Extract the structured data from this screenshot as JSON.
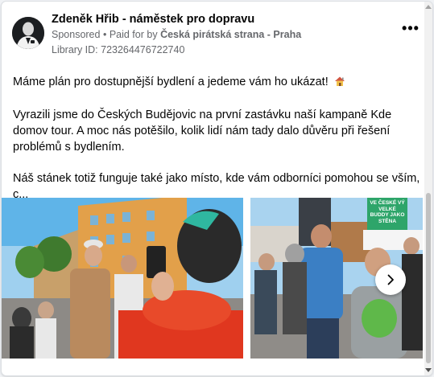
{
  "post": {
    "author": "Zdeněk Hřib - náměstek pro dopravu",
    "sponsored": "Sponsored",
    "paid_for_prefix": "Paid for by",
    "paid_for_by": "Česká pirátská strana - Praha",
    "library_id": "Library ID: 723264476722740",
    "more_label": "•••",
    "paragraphs": [
      "Máme plán pro dostupnější bydlení a jedeme vám ho ukázat!",
      "Vyrazili jsme do Českých Budějovic na první zastávku naší kampaně Kde domov tour. A moc nás potěšilo, kolik lidí nám tady dalo důvěru při řešení problémů s bydlením.",
      "Náš stánek totiž funguje také jako místo, kde vám odborníci pomohou se vším, c..."
    ]
  },
  "media": {
    "slide1_icon": "photo-street-crowd",
    "slide2_icon": "photo-campaign-stand",
    "banner_text_1": "VE ČESKÉ VÝ VELKÉ",
    "banner_text_2": "BUDDY JAKO",
    "banner_text_3": "STĚNA",
    "next_icon": "chevron-right-icon"
  },
  "colors": {
    "accent_green": "#2ea56a",
    "muted_text": "#65676b"
  }
}
